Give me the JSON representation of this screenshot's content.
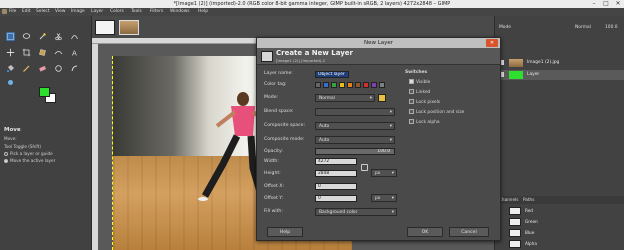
{
  "window": {
    "title": "*[Image1 (2)] (imported)-2.0 (RGB color 8-bit gamma integer, GIMP built-in sRGB, 2 layers) 4272x2848 – GIMP",
    "minimize": "–",
    "maximize": "□",
    "close": "✕"
  },
  "menubar": {
    "items": [
      "File",
      "Edit",
      "Select",
      "View",
      "Image",
      "Layer",
      "Colors",
      "Tools",
      "Filters",
      "Windows",
      "Help"
    ]
  },
  "tool_options": {
    "title": "Move",
    "move_label": "Move:",
    "tool_toggle": "Tool Toggle  (Shift)",
    "opt1": "Pick a layer or guide",
    "opt2": "Move the active layer"
  },
  "colors": {
    "foreground": "#2ee02e",
    "background": "#ffffff",
    "accent": "#d9542c"
  },
  "dock": {
    "mode_label": "Mode",
    "mode_value": "Normal",
    "opacity_value": "100.0",
    "layers": [
      {
        "name": "Image1 (2).jpg"
      },
      {
        "name": "Layer"
      }
    ],
    "tabs": [
      "Channels",
      "Paths"
    ],
    "channels": [
      "Red",
      "Green",
      "Blue",
      "Alpha"
    ]
  },
  "dialog": {
    "window_title": "New Layer",
    "heading": "Create a New Layer",
    "subheading": "[Image1 (2)] (imported)-2",
    "labels": {
      "layer_name": "Layer name:",
      "color_tag": "Color tag:",
      "mode": "Mode:",
      "blend_space": "Blend space:",
      "composite_space": "Composite space:",
      "composite_mode": "Composite mode:",
      "opacity": "Opacity:",
      "width": "Width:",
      "height": "Height:",
      "offset_x": "Offset X:",
      "offset_y": "Offset Y:",
      "fill_with": "Fill with:"
    },
    "values": {
      "layer_name": "Object layer",
      "mode": "Normal",
      "blend_space": "",
      "composite_space": "Auto",
      "composite_mode": "Auto",
      "opacity": "100.0",
      "width": "4272",
      "height": "2848",
      "unit": "px",
      "offset_x": "0",
      "offset_y": "0",
      "fill_with": "Background color"
    },
    "switches": {
      "title": "Switches",
      "items": [
        "Visible",
        "Linked",
        "Lock pixels",
        "Lock position and size",
        "Lock alpha"
      ]
    },
    "buttons": {
      "help": "Help",
      "ok": "OK",
      "cancel": "Cancel"
    }
  }
}
